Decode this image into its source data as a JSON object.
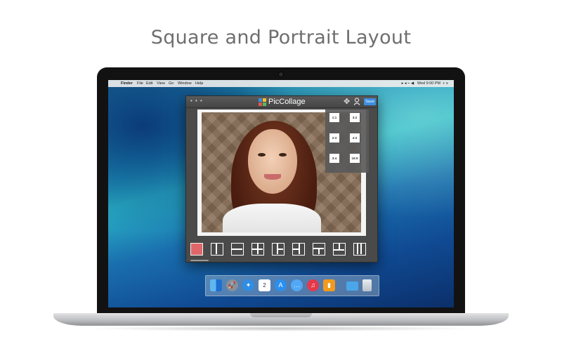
{
  "headline": "Square and Portrait Layout",
  "menubar": {
    "apple_icon": "apple-icon",
    "items": [
      "Finder",
      "File",
      "Edit",
      "View",
      "Go",
      "Window",
      "Help"
    ],
    "clock": "Wed 9:00 PM"
  },
  "app": {
    "title": "PicCollage",
    "window_dots": "• • •",
    "save_label": "Save",
    "ratios": [
      "1:1",
      "3:2",
      "2:3",
      "4:3",
      "3:4",
      "16:9"
    ],
    "layout_count": 9,
    "active_layout_color": "#e0666a"
  },
  "dock": {
    "icons": [
      "finder-icon",
      "launchpad-icon",
      "safari-icon",
      "calendar-icon",
      "app-store-icon",
      "messages-icon",
      "itunes-icon",
      "ibooks-icon",
      "folder-icon",
      "trash-icon"
    ],
    "calendar_day": "2"
  },
  "colors": {
    "save_button": "#3d8fe0",
    "wallpaper": "#1c9ac0"
  }
}
